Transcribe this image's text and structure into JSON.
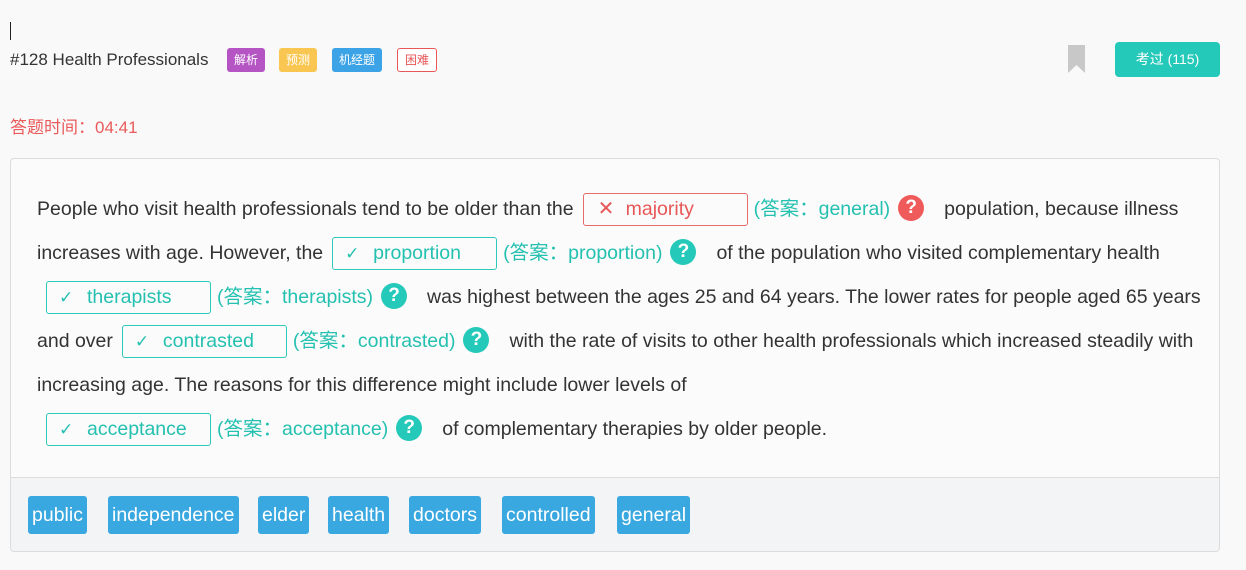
{
  "header": {
    "title": "#128 Health Professionals",
    "tags": [
      "解析",
      "预测",
      "机经题",
      "困难"
    ],
    "pass_button": "考过 (115)"
  },
  "timer": "答题时间：04:41",
  "passage": {
    "seg0": "People who visit health professionals tend to be older than the",
    "blank1": {
      "mark": "✕",
      "value": "majority",
      "answer": "(答案：general)"
    },
    "seg1": "population, because illness increases with age. However, the",
    "blank2": {
      "mark": "✓",
      "value": "proportion",
      "answer": "(答案：proportion)"
    },
    "seg2": "of the population who visited complementary health",
    "blank3": {
      "mark": "✓",
      "value": "therapists",
      "answer": "(答案：therapists)"
    },
    "seg3": "was highest between the ages 25 and 64 years. The lower rates for people aged 65 years and over",
    "blank4": {
      "mark": "✓",
      "value": "contrasted",
      "answer": "(答案：contrasted)"
    },
    "seg4": "with the rate of visits to other health professionals which increased steadily with increasing age. The reasons for this difference might include lower levels of",
    "blank5": {
      "mark": "✓",
      "value": "acceptance",
      "answer": "(答案：acceptance)"
    },
    "seg5": "of complementary therapies by older people.",
    "help_glyph": "?"
  },
  "word_bank": [
    "public",
    "independence",
    "elder",
    "health",
    "doctors",
    "controlled",
    "general"
  ],
  "colors": {
    "accent": "#24c9b9",
    "wrong": "#e85757",
    "word_chip": "#3aa8e0",
    "tag_jiexi": "#b455c3",
    "tag_yuce": "#f9c751",
    "tag_jijing": "#3ba3e6"
  },
  "icons": {
    "bookmark": "bookmark-icon",
    "help": "question-circle-icon",
    "correct": "check-icon",
    "wrong": "cross-icon"
  }
}
